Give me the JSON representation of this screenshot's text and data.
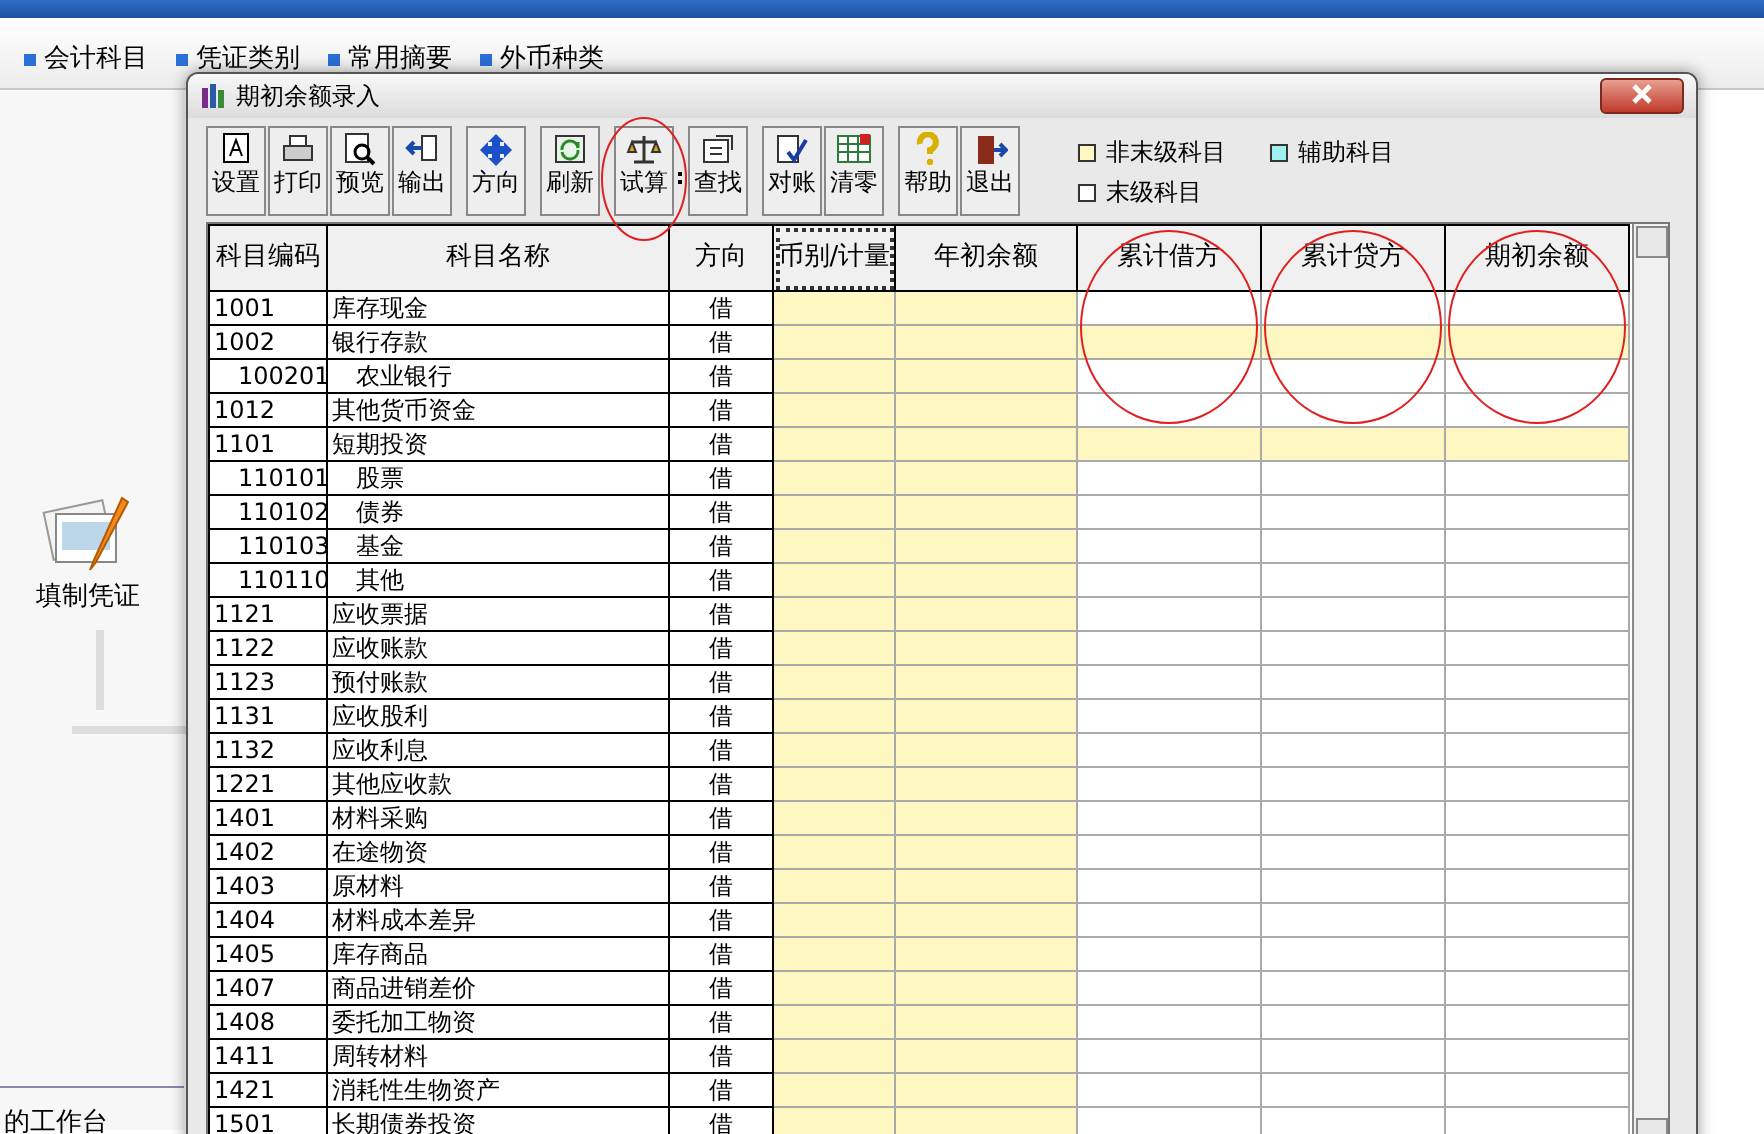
{
  "menu_tabs": [
    {
      "label": "会计科目"
    },
    {
      "label": "凭证类别"
    },
    {
      "label": "常用摘要"
    },
    {
      "label": "外币种类"
    }
  ],
  "desktop_items": [
    {
      "label": "填制凭证"
    }
  ],
  "status_label": "的工作台",
  "dialog": {
    "title": "期初余额录入",
    "toolbar": [
      [
        {
          "label": "设置",
          "kind": "settings",
          "highlighted": false
        },
        {
          "label": "打印",
          "kind": "print",
          "highlighted": false
        },
        {
          "label": "预览",
          "kind": "preview",
          "highlighted": false
        },
        {
          "label": "输出",
          "kind": "export",
          "highlighted": false
        }
      ],
      [
        {
          "label": "方向",
          "kind": "direction",
          "highlighted": false
        }
      ],
      [
        {
          "label": "刷新",
          "kind": "refresh",
          "highlighted": false
        }
      ],
      [
        {
          "label": "试算",
          "kind": "balance",
          "highlighted": true,
          "has_menu": true
        }
      ],
      [
        {
          "label": "查找",
          "kind": "find",
          "highlighted": false
        }
      ],
      [
        {
          "label": "对账",
          "kind": "reconcile",
          "highlighted": false
        },
        {
          "label": "清零",
          "kind": "clear",
          "highlighted": false
        }
      ],
      [
        {
          "label": "帮助",
          "kind": "help",
          "highlighted": false
        },
        {
          "label": "退出",
          "kind": "exit",
          "highlighted": false
        }
      ]
    ],
    "legend": [
      {
        "label": "非末级科目",
        "color": "#fff7c2"
      },
      {
        "label": "辅助科目",
        "color": "#9ff0f0"
      },
      {
        "label": "末级科目",
        "color": "#ffffff"
      }
    ],
    "table": {
      "columns": [
        {
          "label": "科目编码",
          "kind": "code",
          "highlighted": false,
          "selected": false
        },
        {
          "label": "科目名称",
          "kind": "name",
          "highlighted": false,
          "selected": false
        },
        {
          "label": "方向",
          "kind": "direction",
          "highlighted": false,
          "selected": false
        },
        {
          "label": "币别/计量",
          "kind": "input",
          "highlighted": false,
          "selected": true
        },
        {
          "label": "年初余额",
          "kind": "input",
          "highlighted": false,
          "selected": false
        },
        {
          "label": "累计借方",
          "kind": "sum",
          "highlighted": true,
          "selected": false
        },
        {
          "label": "累计贷方",
          "kind": "sum",
          "highlighted": true,
          "selected": false
        },
        {
          "label": "期初余额",
          "kind": "sum",
          "highlighted": true,
          "selected": false
        }
      ],
      "rows": [
        {
          "code": "1001",
          "name": "库存现金",
          "direction": "借"
        },
        {
          "code": "1002",
          "name": "银行存款",
          "direction": "借",
          "children": [
            {
              "code": "100201",
              "name": "农业银行",
              "direction": "借"
            }
          ]
        },
        {
          "code": "1012",
          "name": "其他货币资金",
          "direction": "借"
        },
        {
          "code": "1101",
          "name": "短期投资",
          "direction": "借",
          "children": [
            {
              "code": "110101",
              "name": "股票",
              "direction": "借"
            },
            {
              "code": "110102",
              "name": "债券",
              "direction": "借"
            },
            {
              "code": "110103",
              "name": "基金",
              "direction": "借"
            },
            {
              "code": "110110",
              "name": "其他",
              "direction": "借"
            }
          ]
        },
        {
          "code": "1121",
          "name": "应收票据",
          "direction": "借"
        },
        {
          "code": "1122",
          "name": "应收账款",
          "direction": "借"
        },
        {
          "code": "1123",
          "name": "预付账款",
          "direction": "借"
        },
        {
          "code": "1131",
          "name": "应收股利",
          "direction": "借"
        },
        {
          "code": "1132",
          "name": "应收利息",
          "direction": "借"
        },
        {
          "code": "1221",
          "name": "其他应收款",
          "direction": "借"
        },
        {
          "code": "1401",
          "name": "材料采购",
          "direction": "借"
        },
        {
          "code": "1402",
          "name": "在途物资",
          "direction": "借"
        },
        {
          "code": "1403",
          "name": "原材料",
          "direction": "借"
        },
        {
          "code": "1404",
          "name": "材料成本差异",
          "direction": "借"
        },
        {
          "code": "1405",
          "name": "库存商品",
          "direction": "借"
        },
        {
          "code": "1407",
          "name": "商品进销差价",
          "direction": "借"
        },
        {
          "code": "1408",
          "name": "委托加工物资",
          "direction": "借"
        },
        {
          "code": "1411",
          "name": "周转材料",
          "direction": "借"
        },
        {
          "code": "1421",
          "name": "消耗性生物资产",
          "direction": "借"
        },
        {
          "code": "1501",
          "name": "长期债券投资",
          "direction": "借"
        }
      ]
    }
  }
}
